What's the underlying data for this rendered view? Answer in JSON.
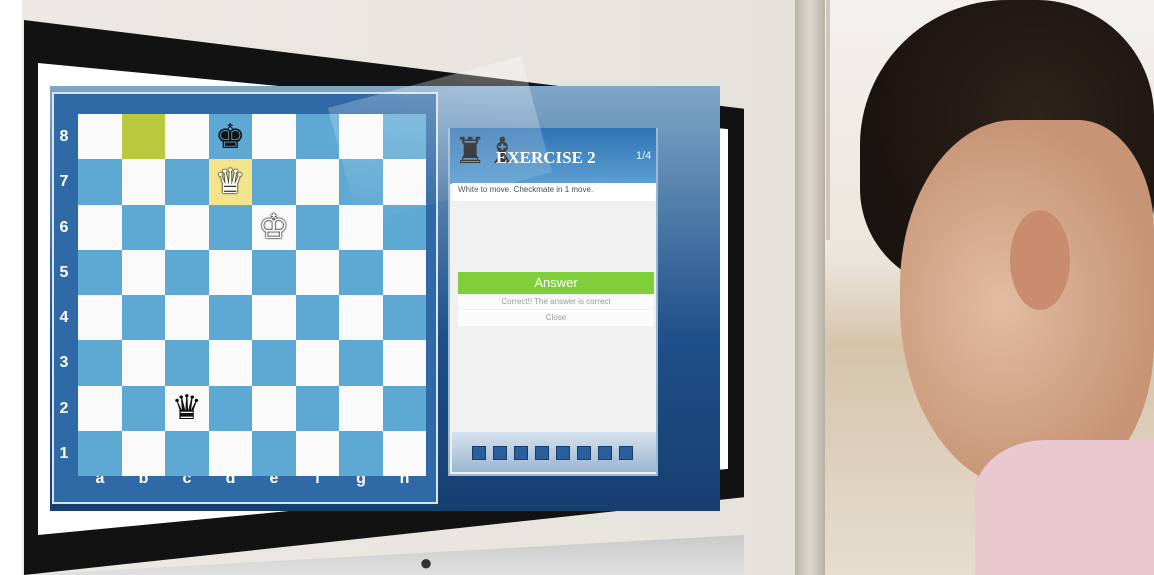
{
  "board": {
    "ranks": [
      "8",
      "7",
      "6",
      "5",
      "4",
      "3",
      "2",
      "1"
    ],
    "files": [
      "a",
      "b",
      "c",
      "d",
      "e",
      "f",
      "g",
      "h"
    ],
    "highlights": {
      "b8": "green",
      "d7": "yellow"
    },
    "pieces": {
      "d8": {
        "glyph": "♚",
        "name": "black-king"
      },
      "d7": {
        "glyph": "♛",
        "name": "white-queen-on-highlight"
      },
      "e6": {
        "glyph": "♔",
        "name": "white-king"
      },
      "c2": {
        "glyph": "♛",
        "name": "black-queen"
      }
    }
  },
  "panel": {
    "title": "EXERCISE 2",
    "count": "1/4",
    "instruction": "White to move. Checkmate in 1 move.",
    "answer_label": "Answer",
    "answer_text": "Correct!! The answer is correct",
    "close_label": "Close"
  },
  "colors": {
    "light_square": "#fafafa",
    "dark_square": "#5ea9d4",
    "green_highlight": "#b9c93d",
    "yellow_highlight": "#f4e58a",
    "answer_green": "#7fcf3a"
  },
  "toolbar": {
    "icons": [
      "first-icon",
      "pause-icon",
      "back-icon",
      "forward-icon",
      "bed-icon",
      "lock-icon",
      "next-icon",
      "grid-icon"
    ]
  }
}
